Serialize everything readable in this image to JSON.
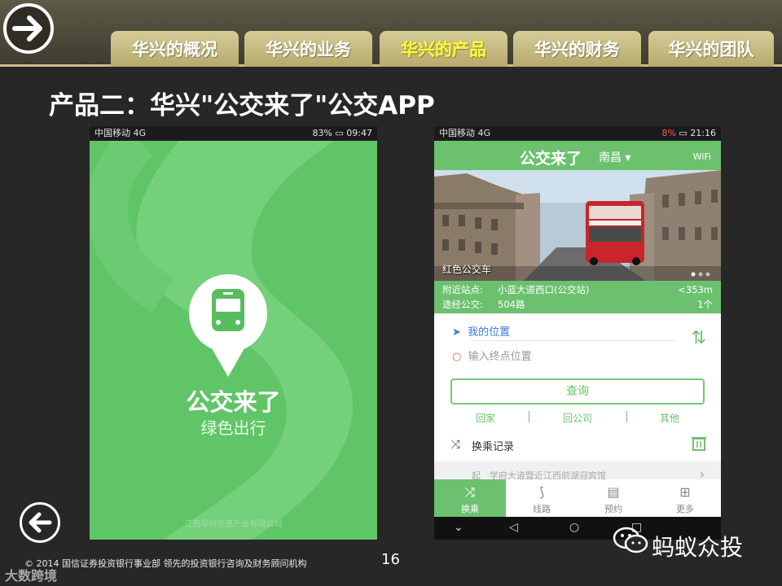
{
  "nav": {
    "tabs": [
      {
        "label": "华兴的概况"
      },
      {
        "label": "华兴的业务"
      },
      {
        "label": "华兴的产品",
        "active": true
      },
      {
        "label": "华兴的财务"
      },
      {
        "label": "华兴的团队"
      }
    ],
    "forward_icon": "arrow-right-circle-icon",
    "back_icon": "arrow-left-circle-icon"
  },
  "slide": {
    "title": "产品二：华兴\"公交来了\"公交APP"
  },
  "phone1": {
    "status": {
      "carrier": "中国移动 4G",
      "signal": "4G",
      "battery": "83%",
      "time": "09:47"
    },
    "app_name": "公交来了",
    "slogan": "绿色出行",
    "company": "江西华兴信息产业有限公司"
  },
  "phone2": {
    "status": {
      "carrier": "中国移动 4G",
      "battery": "8%",
      "time": "21:16"
    },
    "header": {
      "title": "公交来了",
      "city": "南昌",
      "wifi": "WiFi"
    },
    "banner_caption": "红色公交车",
    "nearby": {
      "label": "附近站点:",
      "station": "小蓝大道西口(公交站)",
      "distance": "<353m"
    },
    "lines": {
      "label": "途经公交:",
      "value": "504路",
      "count": "1个"
    },
    "my_location": "我的位置",
    "destination_placeholder": "输入终点位置",
    "query_label": "查询",
    "quick": [
      "回家",
      "回公司",
      "其他"
    ],
    "history_title": "换乘记录",
    "history_item": {
      "start_label": "起",
      "text": "学府大道暨近江西前湖迎宾馆"
    },
    "tabs": [
      "换乘",
      "线路",
      "预约",
      "更多"
    ]
  },
  "footer": {
    "copyright": "© 2014   国信证券投资银行事业部   领先的投资银行咨询及财务顾问机构",
    "page": "16",
    "watermark": "大数跨境",
    "wechat_account": "蚂蚁众投"
  },
  "colors": {
    "app_green": "#60c567",
    "tab_gold": "#c9bd86",
    "active_tab_text": "#fffe2e"
  }
}
